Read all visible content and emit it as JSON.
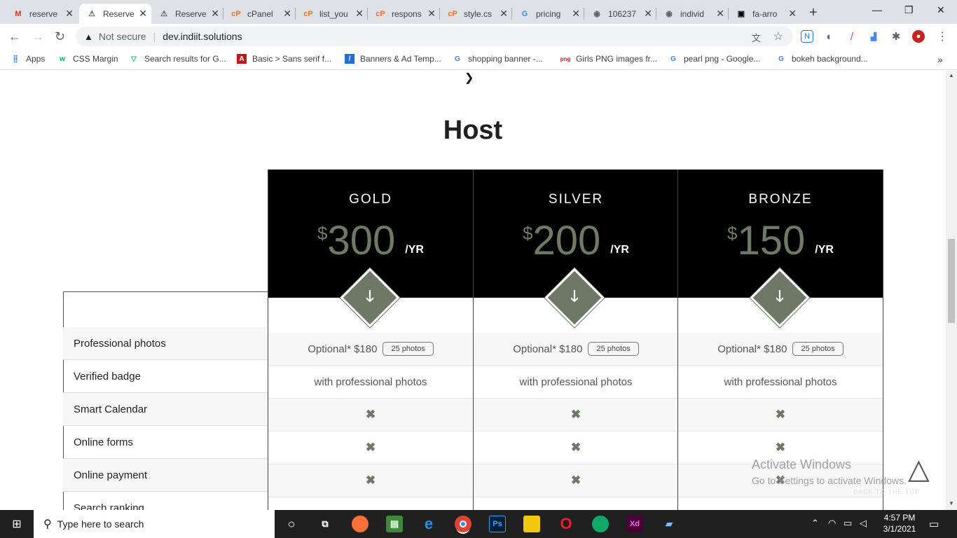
{
  "browser": {
    "tabs": [
      {
        "icon": "gmail-icon",
        "title": "reserve",
        "active": false
      },
      {
        "icon": "vuetify-icon",
        "title": "Reserve",
        "active": true
      },
      {
        "icon": "vuetify-icon",
        "title": "Reserve",
        "active": false
      },
      {
        "icon": "cpanel-icon",
        "title": "cPanel",
        "active": false
      },
      {
        "icon": "cpanel-icon",
        "title": "list_you",
        "active": false
      },
      {
        "icon": "cpanel-icon",
        "title": "respons",
        "active": false
      },
      {
        "icon": "cpanel-icon",
        "title": "style.cs",
        "active": false
      },
      {
        "icon": "google-icon",
        "title": "pricing",
        "active": false
      },
      {
        "icon": "globe-icon",
        "title": "106237",
        "active": false
      },
      {
        "icon": "globe-icon",
        "title": "individ",
        "active": false
      },
      {
        "icon": "fontawesome-icon",
        "title": "fa-arro",
        "active": false
      }
    ],
    "security_label": "Not secure",
    "url": "dev.indiit.solutions",
    "bookmarks": [
      {
        "icon": "apps-grid-icon",
        "label": "Apps"
      },
      {
        "icon": "w3schools-icon",
        "label": "CSS Margin"
      },
      {
        "icon": "vuetify-icon",
        "label": "Search results for G..."
      },
      {
        "icon": "adobe-icon",
        "label": "Basic > Sans serif f..."
      },
      {
        "icon": "bannersnack-icon",
        "label": "Banners & Ad Temp..."
      },
      {
        "icon": "google-icon",
        "label": "shopping banner -..."
      },
      {
        "icon": "pngtree-icon",
        "label": "Girls PNG images fr..."
      },
      {
        "icon": "google-icon",
        "label": "pearl png - Google..."
      },
      {
        "icon": "google-icon",
        "label": "bokeh background..."
      }
    ],
    "bookmarks_more": "»"
  },
  "page": {
    "title": "Host",
    "plans": [
      {
        "name": "GOLD",
        "currency": "$",
        "price": "300",
        "period": "/YR"
      },
      {
        "name": "SILVER",
        "currency": "$",
        "price": "200",
        "period": "/YR"
      },
      {
        "name": "BRONZE",
        "currency": "$",
        "price": "150",
        "period": "/YR"
      }
    ],
    "features": [
      {
        "label": "Professional photos",
        "gold": {
          "text": "Optional* $180",
          "pill": "25 photos"
        },
        "silver": {
          "text": "Optional* $180",
          "pill": "25 photos"
        },
        "bronze": {
          "text": "Optional* $180",
          "pill": "25 photos"
        }
      },
      {
        "label": "Verified badge",
        "gold": {
          "text": "with professional photos"
        },
        "silver": {
          "text": "with professional photos"
        },
        "bronze": {
          "text": "with professional photos"
        }
      },
      {
        "label": "Smart Calendar",
        "gold": {
          "mark": "✖"
        },
        "silver": {
          "mark": "✖"
        },
        "bronze": {
          "mark": "✖"
        }
      },
      {
        "label": "Online forms",
        "gold": {
          "mark": "✖"
        },
        "silver": {
          "mark": "✖"
        },
        "bronze": {
          "mark": "✖"
        }
      },
      {
        "label": "Online payment",
        "gold": {
          "mark": "✖"
        },
        "silver": {
          "mark": "✖"
        },
        "bronze": {
          "mark": "✖"
        }
      },
      {
        "label": "Search ranking",
        "gold": {
          "text": ""
        },
        "silver": {
          "text": ""
        },
        "bronze": {
          "text": ""
        }
      }
    ],
    "accent_color": "#6d7866",
    "back_to_top": "BACK TO THE TOP"
  },
  "watermark": {
    "line1": "Activate Windows",
    "line2": "Go to Settings to activate Windows."
  },
  "taskbar": {
    "search_placeholder": "Type here to search",
    "time": "4:57 PM",
    "date": "3/1/2021"
  }
}
